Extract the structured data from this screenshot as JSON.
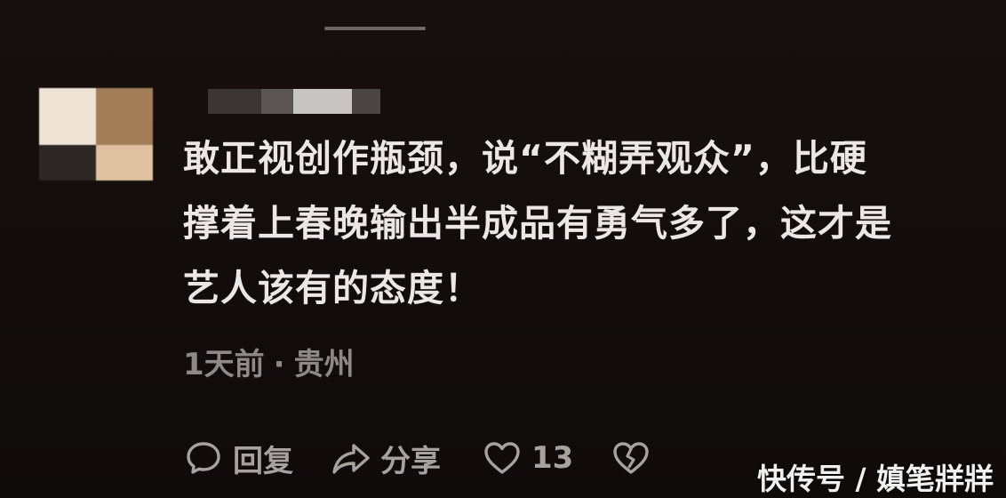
{
  "comment": {
    "line1": "敢正视创作瓶颈，说“不糊弄观众”，比硬",
    "line2": "撑着上春晚输出半成品有勇气多了，这才是",
    "line3": "艺人该有的态度！",
    "time": "1天前",
    "separator": "·",
    "location": "贵州"
  },
  "actions": {
    "reply_label": "回复",
    "share_label": "分享",
    "like_count": "13",
    "reply_icon": "speech-bubble-icon",
    "share_icon": "share-arrow-icon",
    "like_icon": "heart-icon",
    "dislike_icon": "broken-heart-icon"
  },
  "watermark": "快传号 / 嫃笔牂牂",
  "colors": {
    "background": "#120d0c",
    "text": "#ebe7e5",
    "muted": "#8f8985",
    "icons": "#a8a29e"
  },
  "avatar_colors": [
    "#efe3d6",
    "#a27d58",
    "#2c2725",
    "#e0c2a0"
  ],
  "username_colors": [
    "#3a3533",
    "#5b5654",
    "#c7c4c2",
    "#4a4543"
  ]
}
